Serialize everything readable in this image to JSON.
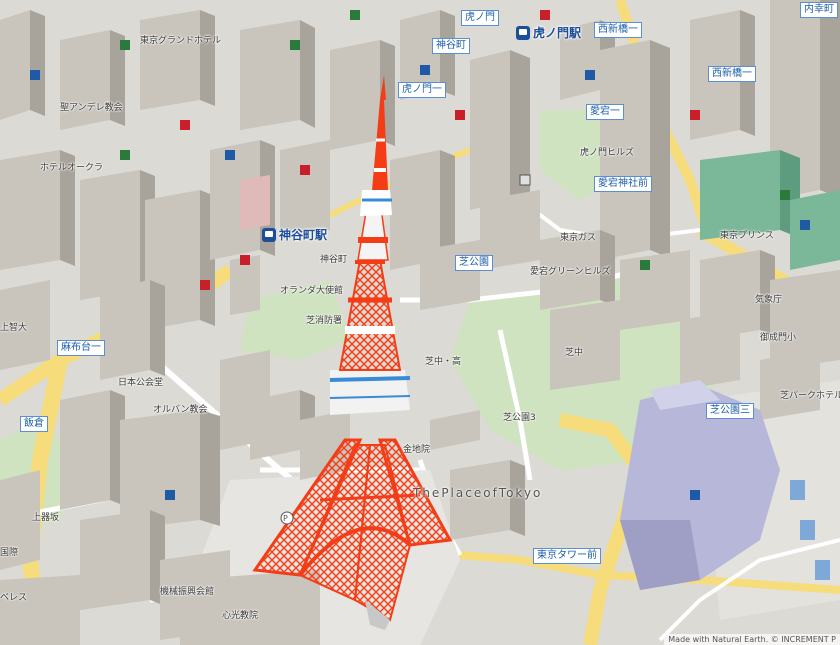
{
  "map": {
    "stations": [
      {
        "key": "kamiyacho",
        "label": "神谷町駅"
      },
      {
        "key": "toranomon",
        "label": "虎ノ門駅"
      }
    ],
    "road_labels": {
      "azabudai": "麻布台一",
      "iigura": "飯倉",
      "shibakoen3": "芝公園三",
      "shibakoen": "芝公園",
      "tokyo_tower_mae": "東京タワー前",
      "atagojinja_mae": "愛宕神社前",
      "toranomon": "虎ノ門",
      "nishishinbashi1": "西新橋一",
      "nishishinbashi": "西新橋一",
      "kamiyacho_cross": "神谷町",
      "atago1": "愛宕一",
      "uchisaiwaicho": "内幸町",
      "toranomon1": "虎ノ門一"
    },
    "place_labels": {
      "the_place": "ThePlaceofTokyo",
      "shiba_kouen_3": "芝公園3",
      "oranda_embassy": "オランダ大使館",
      "shiba_fire": "芝消防署",
      "shiba_chu_ko": "芝中・高",
      "tokyo_grand_hotel": "東京グランドホテル",
      "shinko_kyoin": "心光教院",
      "jokyo": "上智大",
      "kamiyacho_label": "神谷町",
      "nihonkoukyou": "日本公会堂",
      "oruban": "オルバン教会",
      "tokyo_prince": "東京プリンス",
      "shiba_park_hotel": "芝パークホテル",
      "hotel_okura": "ホテルオークラ",
      "kihei": "機械振興会館",
      "kanechi": "金地院",
      "ueki": "上器坂",
      "kokusai": "国際",
      "atago_green": "愛宕グリーンヒルズ",
      "seishoin": "聖アンデレ教会",
      "gojo": "御成門小",
      "shiba_ch": "芝中",
      "tokyo_gas": "東京ガス",
      "kisho": "気象庁",
      "toranomon_hills": "虎ノ門ヒルズ",
      "beres": "ベレス"
    },
    "attribution": "Made with Natural Earth. © INCREMENT P"
  },
  "colors": {
    "background": "#dcdad4",
    "park": "#cfe3c0",
    "road_major": "#f6dc7a",
    "road_minor": "#ffffff",
    "building": "#c9c5bd",
    "building_side": "#a9a49b",
    "tower": "#f43d17",
    "accent_blue": "#1d4e9a",
    "purple_building": "#b7b7d9"
  }
}
